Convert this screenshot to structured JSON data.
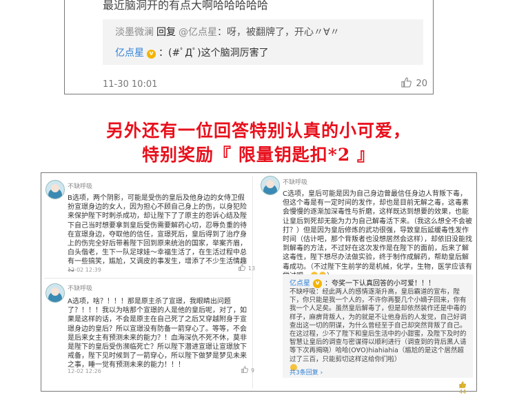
{
  "top_comment": {
    "cut_text": "最近脑洞开的有点大啊哈哈哈哈哈",
    "reply1": {
      "user": "淡墨微澜",
      "reply_word": "回复",
      "target": "@亿点星",
      "text": "：呀，被翻牌了，开心〃∀〃"
    },
    "reply2": {
      "user": "亿点星",
      "badge": "v",
      "text": "：(#ﾟДﾟ)这个脑洞厉害了"
    },
    "time": "11-30 10:01",
    "likes": "20",
    "like_icon": "thumbs-up-icon"
  },
  "headline": {
    "line1": "另外还有一位回答特别认真的小可爱，",
    "line2": "特别奖励『 限量钥匙扣*2 』",
    "color": "#e8101c"
  },
  "comments": [
    {
      "user": "不缺呼吸",
      "text": "B选项，两个阴影，可能是受伤的皇后及他身边的女侍卫假扮宣璟身边的女人，因为担心不顾自己身上的伤，以身犯险来保护陛下时刺杀成功，却让陛下了了原主的怨诉心结及陛下自己当时想要拿到皇后受伤需要解药心切，忍辱负重的待在宣璟身边，夺取他的信任，宣璟死后，皇后得到了治疗身上的伤完全好后带着陛下回到原来统治的国家，举案齐眉，白头偕老，生下一队足球娃～幸福生活了，在生活过程中总有一些搞笑，尴尬，又调皮的事发生，增添了不少生活情趣～",
      "time": "12-02 12:39",
      "likes": "13"
    },
    {
      "user": "不缺呼吸",
      "text": "A选项，啥？！！！那是原主杀了宣璟，我眼睛出问题了？！！！我以为啥那个宣璟的人是他的皇后呢，对了，如果是这样的话，不会是原主在自己死了之后又穿越附身于宣璟身边的皇后？所以宣璟没有防备一箭穿心了。等等，不会是后来女主有预测未来的能力？！血海深仇不死不休，莫非是陛下的皇后受伤濒临死亡？所以陛下潜进宣璟让宣璟放下戒备，陛下见时候到了一箭穿心，所以陛下做梦是梦见未来之事，睡一觉有预测未来的能力！！！",
      "time": "12-02 12:26",
      "likes": "9"
    },
    {
      "user": "不缺呼吸",
      "text": "C选项，皇后可能是因为自己身边曾最信任身边人背叛下毒，但这个毒是有一定时间的发作，却也是目前无解之毒，这毒素会慢慢的逐渐加深毒性与折磨，这样既达到想要的效果，也能让皇后到死却无能为力为自己解毒活下来。（我这么想全不会被打？）但是因为皇后修炼的武功很强，导致皇后延缓毒性发作时间（估计吧，那个背叛者也没想居然会这样），却依旧没能找到解毒的方法，不过好在这次发作是在陛下的面前，后来了解这毒性，陛下想尽办法做实验，终于制作成解药，帮助皇后解毒成功。（不过陛下生前学的是机械，化学，生物，医学应该有学过吧，",
      "time": "",
      "likes": ""
    }
  ],
  "reply_panel": {
    "user": "亿点星",
    "badge": "v",
    "head_text": "：夸奖一下认真回答的小可爱！！！",
    "reply_user": "不缺呼吸",
    "text": "：经此两人的感情逐渐升高，皇后霸道的宣布，陛下，你只能是我一个人的，不许你再娶几个小嫡子回来，你有我一个人足矣。虽然皇后解毒了，但是却依然装作还是中毒的样子，麻痹背叛人，为的就是不让他身后的人发觉，自己好调查出这一切的阴谋，为什么曾经至于自己却突然背叛了自己。在这过程，少不了陛下和皇后生活中的小甜蜜，及陛下及时的智慧让皇后的调查与密谋得以顺利进行（调查到的背后黑人请等下次再揭晓）哈哈(O∀O)hiahiahia（尴尬的是这个居然超过了三百，只能剪切这样这给你们啦）",
    "more": "共3条回复 ›",
    "likes": "44"
  }
}
